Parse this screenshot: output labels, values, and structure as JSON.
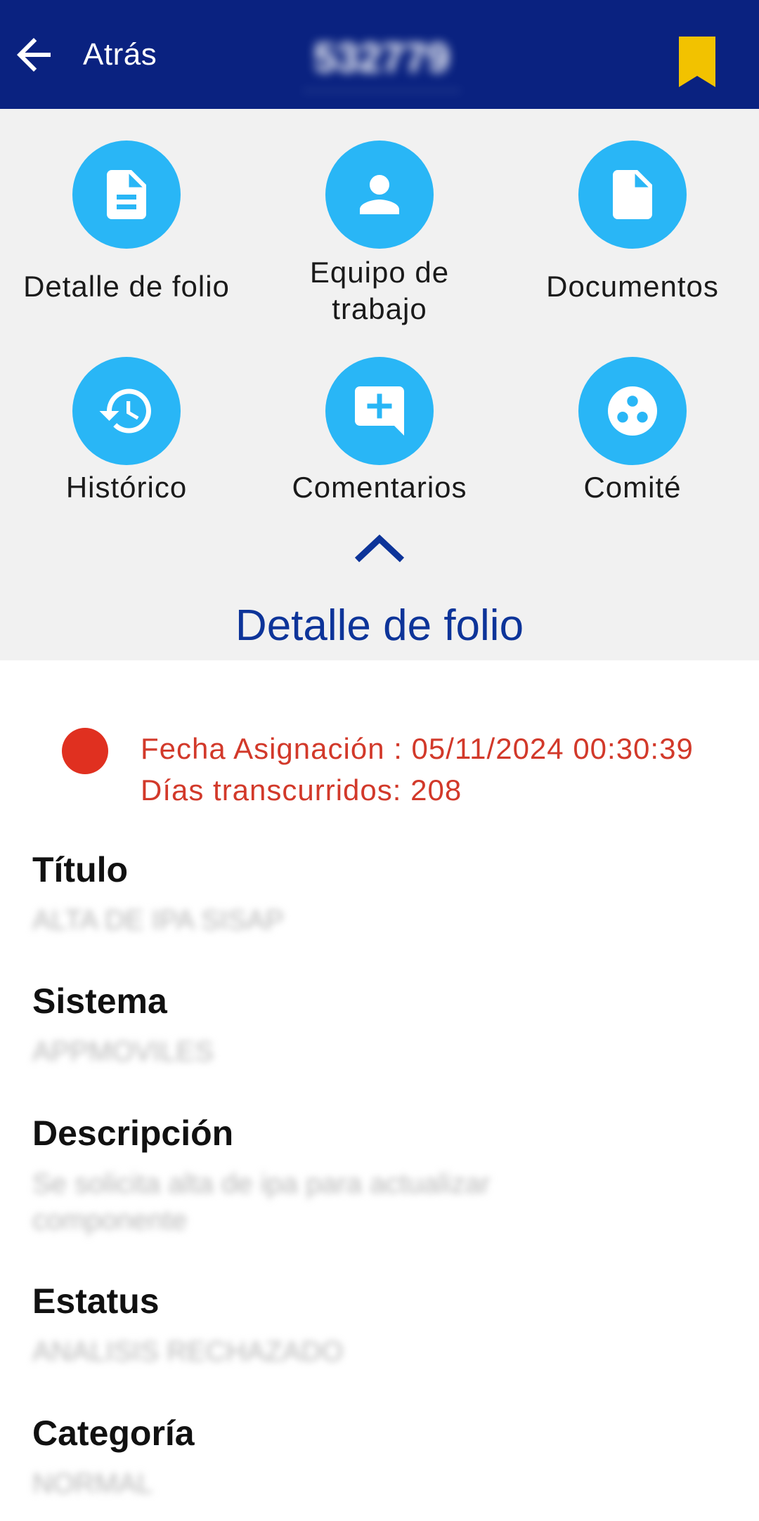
{
  "header": {
    "back_label": "Atrás",
    "folio_number": "532779",
    "bookmark_color": "#f2c200",
    "bar_color": "#0a2280"
  },
  "menu": {
    "items": [
      {
        "label": "Detalle de folio",
        "icon": "document-lines-icon"
      },
      {
        "label": "Equipo de trabajo",
        "icon": "person-icon"
      },
      {
        "label": "Documentos",
        "icon": "file-icon"
      },
      {
        "label": "Histórico",
        "icon": "history-icon"
      },
      {
        "label": "Comentarios",
        "icon": "comment-add-icon"
      },
      {
        "label": "Comité",
        "icon": "group-dots-icon"
      }
    ],
    "accent_color": "#29b6f6",
    "collapse_icon": "chevron-up-icon"
  },
  "section_title": "Detalle de folio",
  "status": {
    "assigned_line": "Fecha Asignación : 05/11/2024 00:30:39",
    "elapsed_line": "Días transcurridos: 208",
    "indicator_color": "#e03020"
  },
  "fields": [
    {
      "label": "Título",
      "value": "ALTA DE IPA SISAP"
    },
    {
      "label": "Sistema",
      "value": "APPMOVILES"
    },
    {
      "label": "Descripción",
      "value": "Se solicita alta de ipa para actualizar componente"
    },
    {
      "label": "Estatus",
      "value": "ANALISIS RECHAZADO"
    },
    {
      "label": "Categoría",
      "value": "NORMAL"
    }
  ]
}
